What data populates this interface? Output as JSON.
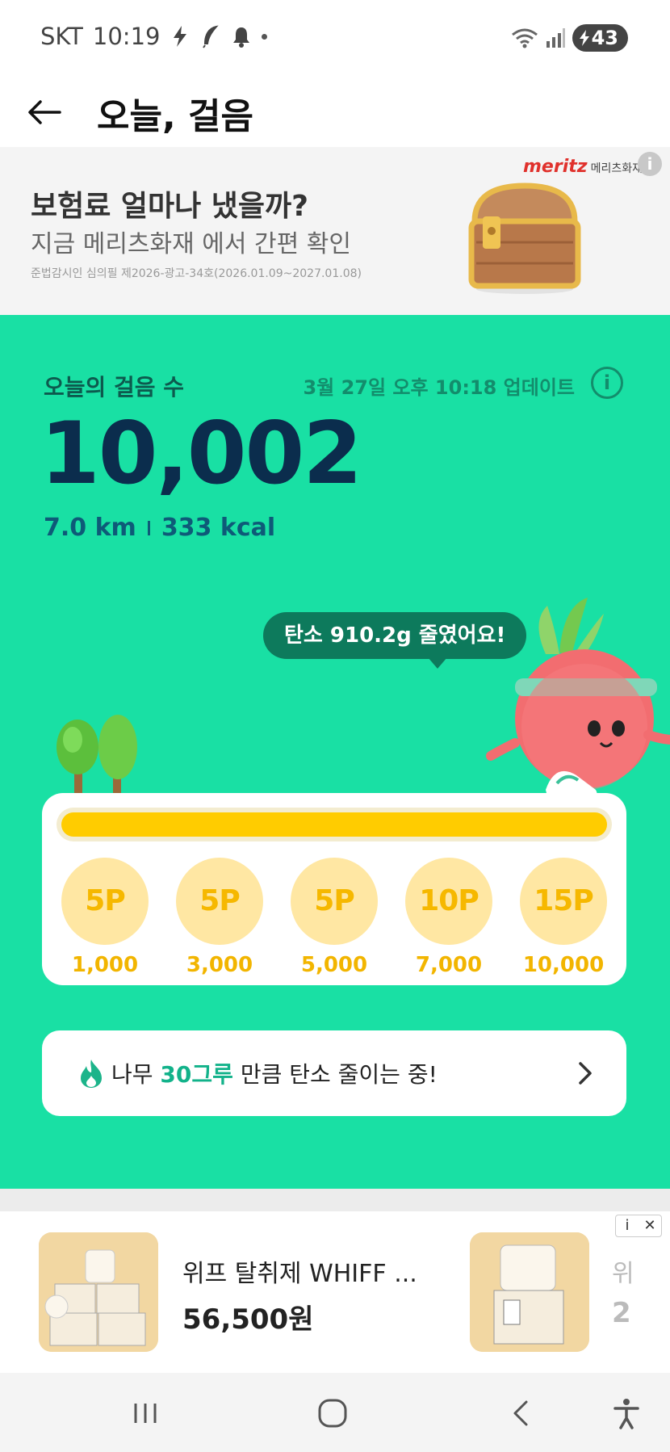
{
  "status_bar": {
    "carrier": "SKT",
    "time": "10:19",
    "battery": "43"
  },
  "header": {
    "title": "오늘, 걸음"
  },
  "top_ad": {
    "brand": "meritz",
    "brand_sub": "메리츠화재",
    "headline": "보험료 얼마나 냈을까?",
    "sub": "지금 메리츠화재 에서 간편 확인",
    "fine_print": "준법감시인 심의필 제2026-광고-34호(2026.01.09~2027.01.08)"
  },
  "steps": {
    "label": "오늘의 걸음 수",
    "updated": "3월 27일 오후 10:18 업데이트",
    "count": "10,002",
    "distance": "7.0 km",
    "calories": "333 kcal",
    "carbon_message": "탄소 910.2g 줄였어요!",
    "progress_fraction": 1.0
  },
  "milestones": [
    {
      "points": "5P",
      "steps": "1,000"
    },
    {
      "points": "5P",
      "steps": "3,000"
    },
    {
      "points": "5P",
      "steps": "5,000"
    },
    {
      "points": "10P",
      "steps": "7,000"
    },
    {
      "points": "15P",
      "steps": "10,000"
    }
  ],
  "tree_banner": {
    "prefix": "나무 ",
    "highlight": "30그루",
    "suffix": " 만큼 탄소 줄이는 중!"
  },
  "bottom_ad": {
    "product_name": "위프 탈취제 WHIFF ...",
    "price": "56,500원",
    "product2_name_partial": "위",
    "product2_price_partial": "2"
  },
  "colors": {
    "green": "#19e0a4",
    "navy": "#0b2d4d",
    "yellow": "#ffcc00",
    "milestone_bg": "#ffe7a3"
  }
}
